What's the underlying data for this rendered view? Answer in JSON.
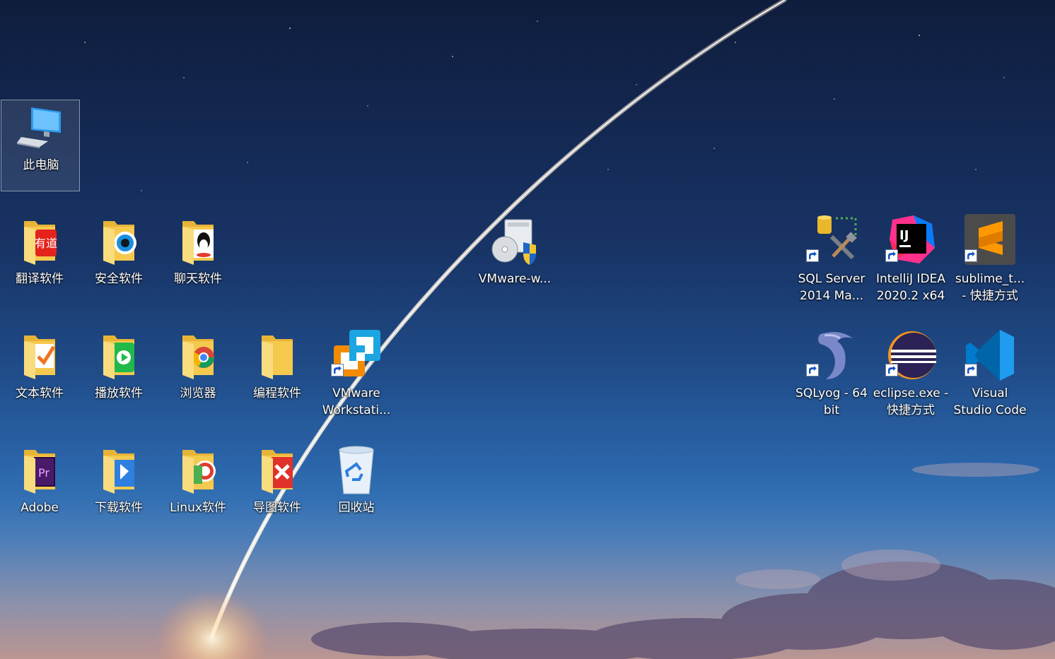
{
  "desktop": {
    "icons": [
      {
        "label": "此电脑",
        "icon": "computer-icon"
      },
      {
        "label": "翻译软件",
        "icon": "folder-translate-icon"
      },
      {
        "label": "安全软件",
        "icon": "folder-security-icon"
      },
      {
        "label": "聊天软件",
        "icon": "folder-chat-icon"
      },
      {
        "label": "VMware-w...",
        "icon": "vmware-installer-icon"
      },
      {
        "label": "SQL Server\n2014 Ma...",
        "icon": "sql-server-icon"
      },
      {
        "label": "IntelliJ IDEA\n2020.2 x64",
        "icon": "intellij-icon"
      },
      {
        "label": "sublime_t...\n- 快捷方式",
        "icon": "sublime-icon"
      },
      {
        "label": "文本软件",
        "icon": "folder-text-icon"
      },
      {
        "label": "播放软件",
        "icon": "folder-player-icon"
      },
      {
        "label": "浏览器",
        "icon": "folder-browser-icon"
      },
      {
        "label": "编程软件",
        "icon": "folder-icon"
      },
      {
        "label": "VMware\nWorkstati...",
        "icon": "vmware-workstation-icon"
      },
      {
        "label": "SQLyog - 64\nbit",
        "icon": "sqlyog-icon"
      },
      {
        "label": "eclipse.exe -\n快捷方式",
        "icon": "eclipse-icon"
      },
      {
        "label": "Visual\nStudio Code",
        "icon": "vscode-icon"
      },
      {
        "label": "Adobe",
        "icon": "folder-adobe-icon"
      },
      {
        "label": "下载软件",
        "icon": "folder-download-icon"
      },
      {
        "label": "Linux软件",
        "icon": "folder-linux-icon"
      },
      {
        "label": "导图软件",
        "icon": "folder-mindmap-icon"
      },
      {
        "label": "回收站",
        "icon": "recycle-bin-icon"
      }
    ]
  },
  "colors": {
    "label_text": "#ffffff",
    "folder_yellow": "#f5c94e",
    "selection_border": "#ffffff"
  }
}
